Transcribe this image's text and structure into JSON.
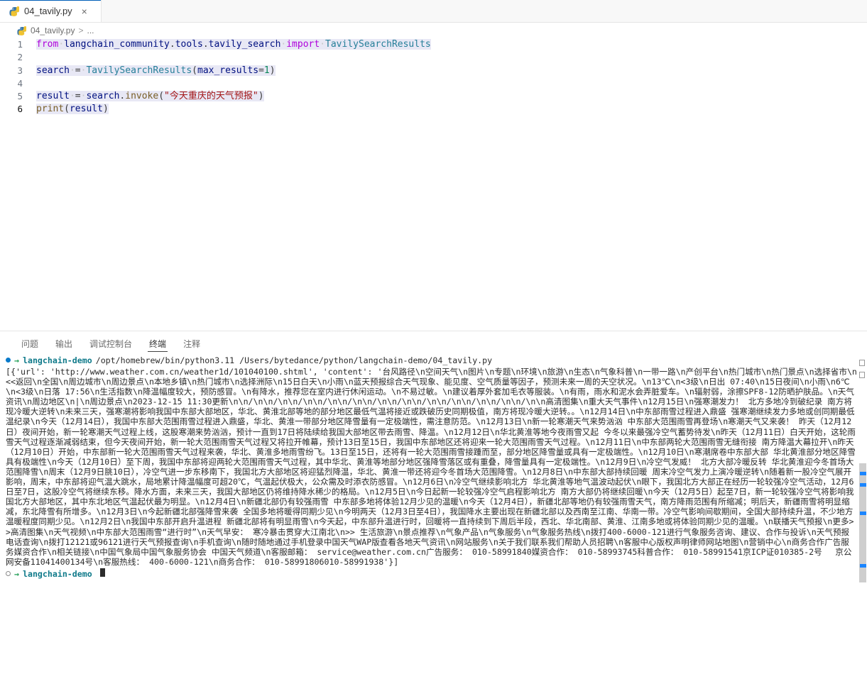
{
  "tab": {
    "label": "04_tavily.py",
    "icon": "python-file-icon",
    "close_label": "×"
  },
  "breadcrumb": {
    "file": "04_tavily.py",
    "separator": ">",
    "ellipsis": "..."
  },
  "editor": {
    "lines": [
      {
        "num": "1",
        "text": "from langchain_community.tools.tavily_search import TavilySearchResults"
      },
      {
        "num": "2",
        "text": ""
      },
      {
        "num": "3",
        "text": "search = TavilySearchResults(max_results=1)"
      },
      {
        "num": "4",
        "text": ""
      },
      {
        "num": "5",
        "text": "result = search.invoke(\"今天重庆的天气预报\")"
      },
      {
        "num": "6",
        "text": "print(result)"
      }
    ]
  },
  "panel": {
    "tabs": [
      {
        "label": "问题",
        "active": false
      },
      {
        "label": "输出",
        "active": false
      },
      {
        "label": "调试控制台",
        "active": false
      },
      {
        "label": "终端",
        "active": true
      },
      {
        "label": "注释",
        "active": false
      }
    ]
  },
  "terminal": {
    "prompt_arrow": "→",
    "cwd": "langchain-demo",
    "command": "/opt/homebrew/bin/python3.11 /Users/bytedance/python/langchain-demo/04_tavily.py",
    "output": "[{'url': 'http://www.weather.com.cn/weather1d/101040100.shtml', 'content': '台风路径\\n空间天气\\n图片\\n专题\\n环境\\n旅游\\n生态\\n气象科普\\n一带一路\\n产创平台\\n热门城市\\n热门景点\\n选择省市\\n<<返回\\n全国\\n周边城市\\n周边景点\\n本地乡镇\\n热门城市\\n选择洲际\\n15日白天\\n小雨\\n蓝天预报综合天气现象、能见度、空气质量等因子，预测未来一周的天空状况。\\n13℃\\n<3级\\n日出 07:40\\n15日夜间\\n小雨\\n6℃\\n<3级\\n日落 17:56\\n生活指数\\n降温幅度较大，预防感冒。\\n有降水，推荐您在室内进行休闲运动。\\n不易过敏。\\n建议着厚外套加毛衣等服装。\\n有雨，雨水和泥水会弄脏爱车。\\n辐射弱，涂擦SPF8-12防晒护肤品。\\n天气资讯\\n周边地区\\n|\\n周边景点\\n2023-12-15 11:30更新\\n\\n/\\n\\n/\\n\\n/\\n\\n/\\n\\n/\\n\\n/\\n\\n/\\n\\n/\\n\\n/\\n\\n/\\n\\n/\\n\\n/\\n\\n高清图集\\n重大天气事件\\n12月15日\\n强寒潮发力！ 北方多地冷到破纪录 南方将现冷暖大逆转\\n未来三天，强寒潮将影响我国中东部大部地区，华北、黄淮北部等地的部分地区最低气温将接近或跌破历史同期极值，南方将现冷暖大逆转。。\\n12月14日\\n中东部雨雪过程进入鼎盛 强寒潮继续发力多地或创同期最低温纪录\\n今天（12月14日），我国中东部大范围雨雪过程进入鼎盛，华北、黄淮一带部分地区降雪量有一定极端性，需注意防范。\\n12月13日\\n新一轮寒潮天气来势汹汹 中东部大范围雨雪再登场\\n寒潮天气又来袭！ 昨天（12月12日）夜间开始，新一轮寒潮天气过程上线，这股寒潮来势汹汹，预计一直到17日将陆续给我国大部地区带去雨雪、降温。\\n12月12日\\n华北黄淮等地今夜雨雪又起 今冬以来最强冷空气蓄势待发\\n昨天（12月11日）白天开始，这轮雨雪天气过程逐渐减弱结束，但今天夜间开始，新一轮大范围雨雪天气过程又将拉开帷幕，预计13日至15日，我国中东部地区还将迎来一轮大范围雨雪天气过程。\\n12月11日\\n中东部两轮大范围雨雪无缝衔接 南方降温大幕拉开\\n昨天（12月10日）开始，中东部新一轮大范围雨雪天气过程来袭，华北、黄淮多地雨雪纷飞。13日至15日，还将有一轮大范围雨雪接踵而至，部分地区降雪量或具有一定极端性。\\n12月10日\\n寒潮席卷中东部大部 华北黄淮部分地区降雪具有极端性\\n今天（12月10日）至下周，我国中东部将迎两轮大范围雨雪天气过程，其中华北、黄淮等地部分地区强降雪落区或有重叠，降雪量具有一定极端性。\\n12月9日\\n冷空气发威！ 北方大部冷暖反转 华北黄淮迎今冬首场大范围降雪\\n周末（12月9日脁10日），冷空气进一步东移南下，我国北方大部地区将迎猛烈降温，华北、黄淮一带还将迎今冬首场大范围降雪。\\n12月8日\\n中东部大部持续回暖 周末冷空气发力上演冷暖逆转\\n随着新一股冷空气展开影响，周末，中东部将迎气温大跳水，局地累计降温幅度可超20℃，气温起伏极大，公众需及时添衣防感冒。\\n12月6日\\n冷空气继续影响北方 华北黄淮等地气温波动起伏\\n眼下，我国北方大部正在经历一轮较强冷空气活动，12月6日至7日，这股冷空气将继续东移。降水方面，未来三天，我国大部地区仍将维持降水稀少的格局。\\n12月5日\\n今日起新一轮较强冷空气启程影响北方 南方大部仍将继续回暖\\n今天（12月5日）起至7日，新一轮较强冷空气将影响我国北方大部地区，其中东北地区气温起伏最为明显。\\n12月4日\\n新疆北部仍有较强雨雪 中东部多地将体验12月少见的温暖\\n今天（12月4日），新疆北部等地仍有较强雨雪天气，南方降雨范围有所缩减；明后天，新疆雨雪将明显缩减，东北降雪有所增多。\\n12月3日\\n今起新疆北部强降雪来袭 全国多地将暖得同期少见\\n今明两天（12月3日至4日），我国降水主要出现在新疆北部以及西南至江南、华南一带。冷空气影响间歇期间，全国大部持续升温，不少地方温暖程度同期少见。\\n12月2日\\n我国中东部开启升温进程 新疆北部将有明显雨雪\\n今天起，中东部升温进行时，回暖将一直持续到下周后半段，西北、华北南部、黄淮、江南多地或将体验同期少见的温暖。\\n联播天气预报\\n更多>>高清图集\\n天气视频\\n中东部大范围雨雪“进行时”\\n天气早安： 寒冷暴击贯穿大江南北\\n>> 生活旅游\\n景点推荐\\n气象产品\\n气象服务\\n气象服务热线\\n拨打400-6000-121进行气象服务咨询、建议、合作与投诉\\n天气预报电话查询\\n拨打12121或96121进行天气预报查询\\n手机查询\\n随时随地通过手机登录中国天气WAP版查看各地天气资讯\\n网站服务\\n关于我们联系我们帮助人员招聘\\n客服中心版权声明律师网站地图\\n营销中心\\n商务合作广告服务媒资合作\\n相关链接\\n中国气象局中国气象服务协会 中国天气频道\\n客服邮箱： service@weather.com.cn广告服务： 010-58991840媒资合作： 010-58993745科普合作： 010-58991541京ICP证010385-2号 　京公网安备11041400134号\\n客服热线： 400-6000-121\\n商务合作： 010-58991806010-58991938'}]",
    "final_prompt_cwd": "langchain-demo"
  },
  "colors": {
    "accent": "#005fb8",
    "terminal_cwd": "#0f7a8a",
    "arrow_green": "#1f9c54",
    "status_dot": "#0a7aca",
    "scrollbar": "#bdbdbd",
    "overview_mark": "#1a85ff"
  }
}
